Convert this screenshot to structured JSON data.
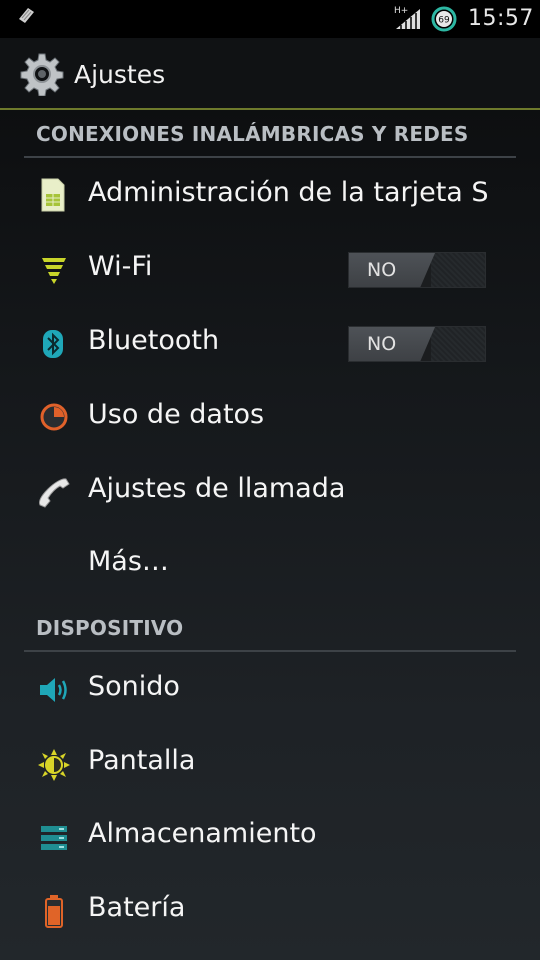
{
  "status_bar": {
    "network_type": "H+",
    "battery_level": "69",
    "time": "15:57"
  },
  "action_bar": {
    "title": "Ajustes",
    "icon": "gear-icon"
  },
  "sections": [
    {
      "header": "CONEXIONES INALÁMBRICAS Y REDES",
      "items": [
        {
          "label": "Administración de la tarjeta SIM",
          "icon": "sim-card-icon"
        },
        {
          "label": "Wi-Fi",
          "icon": "wifi-icon",
          "toggle": "NO"
        },
        {
          "label": "Bluetooth",
          "icon": "bluetooth-icon",
          "toggle": "NO"
        },
        {
          "label": "Uso de datos",
          "icon": "data-usage-icon"
        },
        {
          "label": "Ajustes de llamada",
          "icon": "phone-handset-icon"
        },
        {
          "label": "Más…"
        }
      ]
    },
    {
      "header": "DISPOSITIVO",
      "items": [
        {
          "label": "Sonido",
          "icon": "speaker-icon"
        },
        {
          "label": "Pantalla",
          "icon": "display-brightness-icon"
        },
        {
          "label": "Almacenamiento",
          "icon": "storage-icon"
        },
        {
          "label": "Batería",
          "icon": "battery-icon"
        }
      ]
    }
  ],
  "colors": {
    "accent_line": "#6e7a2c",
    "wifi_icon": "#c8d52a",
    "bluetooth_icon": "#1fa7b8",
    "data_usage_icon": "#e0612a",
    "speaker_icon": "#1fa7b8",
    "display_icon": "#d8d428",
    "storage_icon": "#1f8e92",
    "battery_icon": "#e06428"
  }
}
